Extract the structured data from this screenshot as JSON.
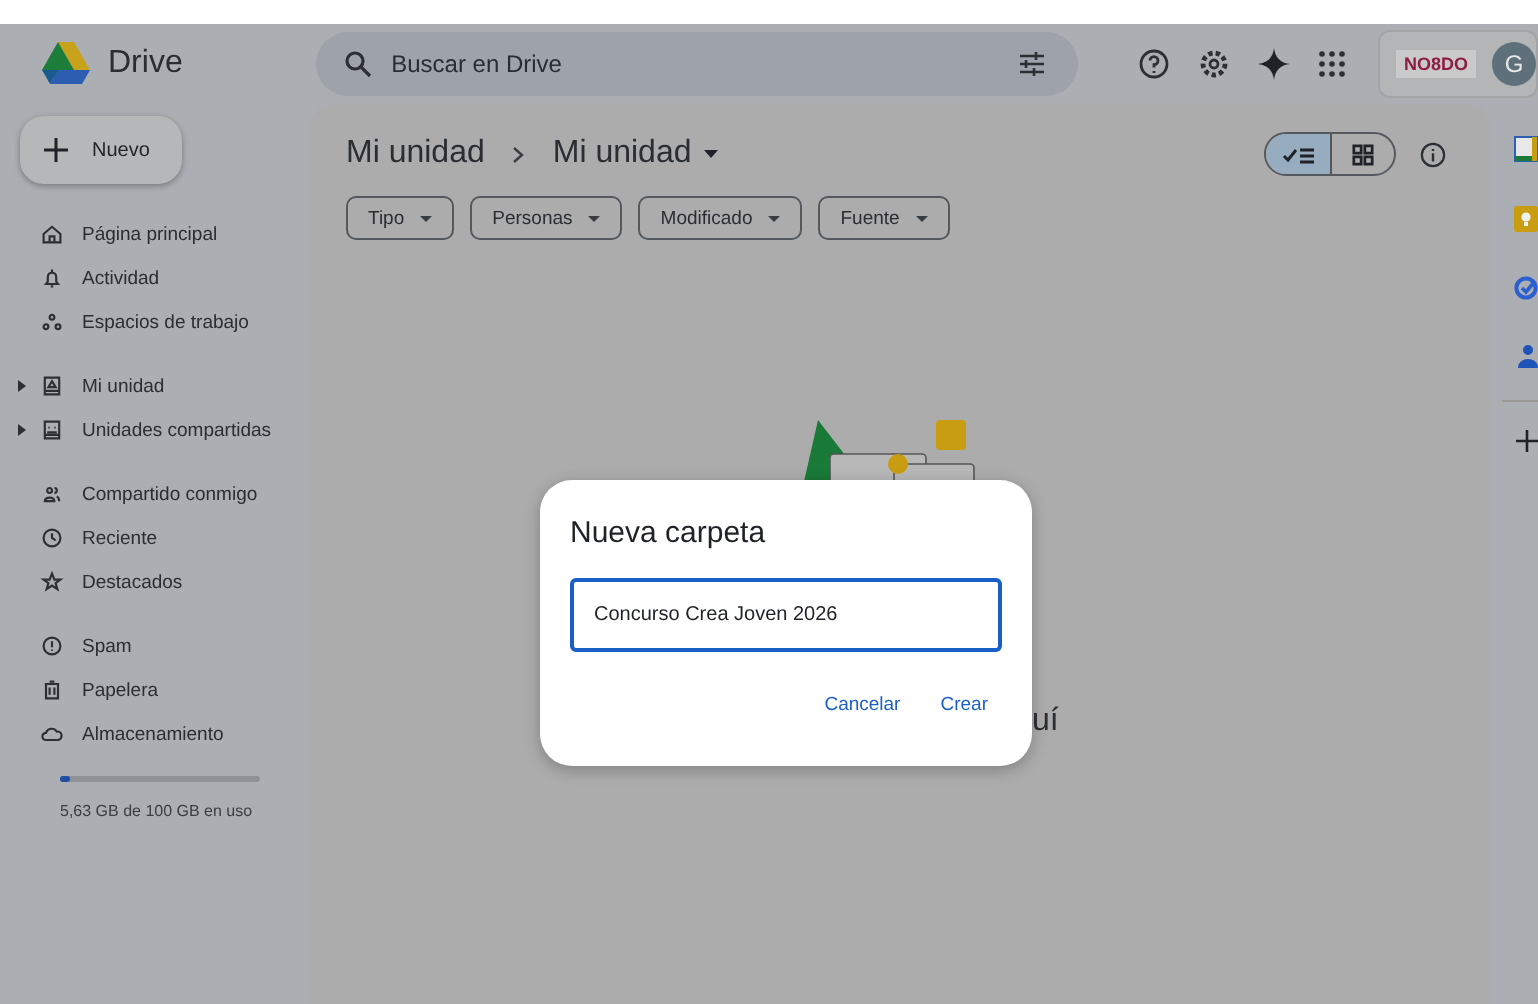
{
  "app": {
    "name": "Drive"
  },
  "search": {
    "placeholder": "Buscar en Drive"
  },
  "org_logo": {
    "text": "NO8DO"
  },
  "avatar": {
    "initial": "G"
  },
  "new_button": {
    "label": "Nuevo"
  },
  "sidebar": {
    "groups": [
      [
        {
          "label": "Página principal"
        },
        {
          "label": "Actividad"
        },
        {
          "label": "Espacios de trabajo"
        }
      ],
      [
        {
          "label": "Mi unidad",
          "expandable": true
        },
        {
          "label": "Unidades compartidas",
          "expandable": true
        }
      ],
      [
        {
          "label": "Compartido conmigo"
        },
        {
          "label": "Reciente"
        },
        {
          "label": "Destacados"
        }
      ],
      [
        {
          "label": "Spam"
        },
        {
          "label": "Papelera"
        },
        {
          "label": "Almacenamiento"
        }
      ]
    ]
  },
  "storage": {
    "level": 0.05,
    "text": "5,63 GB de 100 GB en uso"
  },
  "breadcrumb": [
    "Mi unidad",
    "Mi unidad"
  ],
  "view_toggle": [
    {
      "kind": "list",
      "selected": true
    },
    {
      "kind": "grid",
      "selected": false
    }
  ],
  "filters": [
    "Tipo",
    "Personas",
    "Modificado",
    "Fuente"
  ],
  "empty_state_text": "uí",
  "dialog": {
    "title": "Nueva carpeta",
    "value": "Concurso Crea Joven 2026",
    "buttons": [
      "Cancelar",
      "Crear"
    ]
  }
}
